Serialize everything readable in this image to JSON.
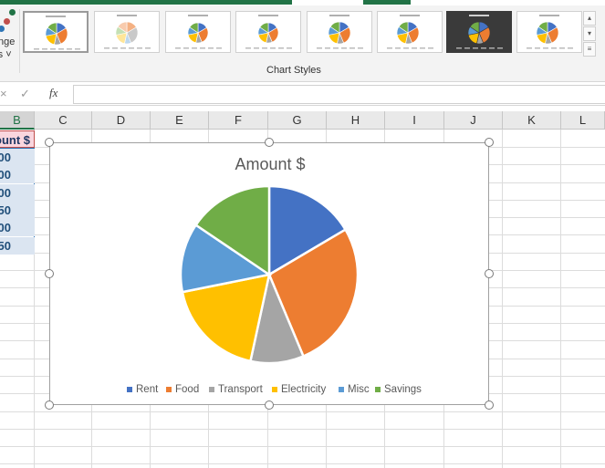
{
  "ribbon": {
    "change_colors_label_line1": "nge",
    "change_colors_label_line2": "rs ˅",
    "group_label": "Chart Styles",
    "style_thumbnails": [
      {
        "name": "Style 1",
        "selected": true
      },
      {
        "name": "Style 2",
        "selected": false
      },
      {
        "name": "Style 3",
        "selected": false
      },
      {
        "name": "Style 4",
        "selected": false
      },
      {
        "name": "Style 5",
        "selected": false
      },
      {
        "name": "Style 6",
        "selected": false
      },
      {
        "name": "Style 7",
        "selected": false
      },
      {
        "name": "Style 8",
        "selected": false
      }
    ],
    "scroll_up": "▴",
    "scroll_down": "▾",
    "more": "≡"
  },
  "formula_bar": {
    "cancel_icon": "×",
    "enter_icon": "✓",
    "fx_label": "fx",
    "value": ""
  },
  "columns": [
    "B",
    "C",
    "D",
    "E",
    "F",
    "G",
    "H",
    "I",
    "J",
    "K",
    "L"
  ],
  "cells": {
    "header": "ount $",
    "values": [
      "00",
      "00",
      "00",
      "50",
      "00",
      "50"
    ]
  },
  "chart_data": {
    "type": "pie",
    "title": "Amount $",
    "categories": [
      "Rent",
      "Food",
      "Transport",
      "Electricity",
      "Misc",
      "Savings"
    ],
    "values": [
      17,
      28,
      10,
      19,
      13,
      16
    ],
    "colors": [
      "#4472c4",
      "#ed7d31",
      "#a5a5a5",
      "#ffc000",
      "#5b9bd5",
      "#70ad47"
    ],
    "legend": "bottom"
  },
  "colors": {
    "accent_green": "#217346",
    "header_fill": "#f9d6de",
    "value_fill": "#dbe5f1"
  }
}
